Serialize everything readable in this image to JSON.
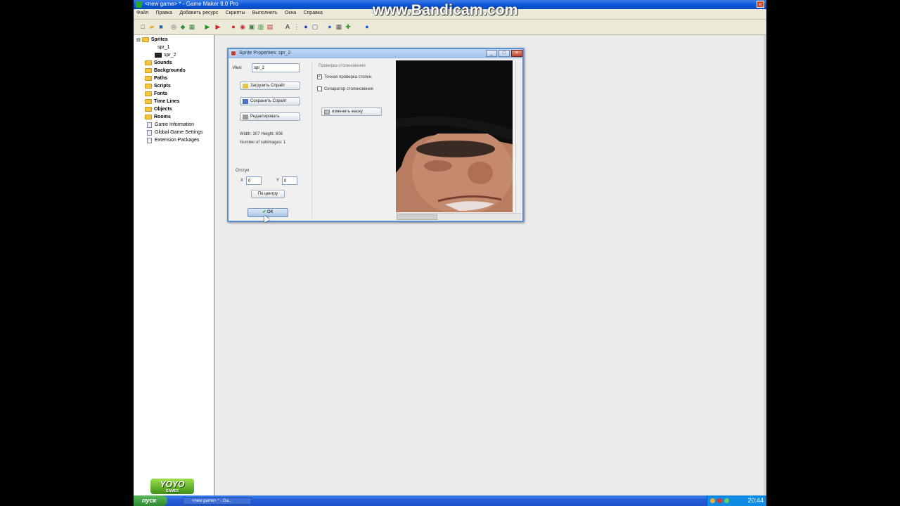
{
  "window": {
    "title": "<new game> * - Game Maker 8.0 Pro",
    "close_icon": "×"
  },
  "watermark": "www.Bandicam.com",
  "menu": [
    "Файл",
    "Правка",
    "Добавить ресурс",
    "Скрипты",
    "Выполнить",
    "Окна",
    "Справка"
  ],
  "toolbar_icons": [
    {
      "name": "new-icon",
      "glyph": "□",
      "color": "#555"
    },
    {
      "name": "open-icon",
      "glyph": "▰",
      "color": "#e0b02a"
    },
    {
      "name": "save-icon",
      "glyph": "■",
      "color": "#2a5fb0"
    },
    {
      "name": "find-icon",
      "glyph": "◎",
      "color": "#555"
    },
    {
      "name": "publish-icon",
      "glyph": "◆",
      "color": "#3a8a3a"
    },
    {
      "name": "export-icon",
      "glyph": "▦",
      "color": "#3a8a3a"
    },
    {
      "name": "run-icon",
      "glyph": "▶",
      "color": "#1a9a1a"
    },
    {
      "name": "debug-icon",
      "glyph": "▶",
      "color": "#d02020"
    },
    {
      "name": "sprite-icon",
      "glyph": "●",
      "color": "#d02020"
    },
    {
      "name": "sound-icon",
      "glyph": "◉",
      "color": "#c03030"
    },
    {
      "name": "background-icon",
      "glyph": "▣",
      "color": "#3a7a3a"
    },
    {
      "name": "path-icon",
      "glyph": "▥",
      "color": "#2a8a2a"
    },
    {
      "name": "script-icon",
      "glyph": "▤",
      "color": "#c03030"
    },
    {
      "name": "font-icon",
      "glyph": "A",
      "color": "#222"
    },
    {
      "name": "timeline-icon",
      "glyph": "⋮",
      "color": "#2a5fb0"
    },
    {
      "name": "object-icon",
      "glyph": "●",
      "color": "#1a44c8"
    },
    {
      "name": "room-icon",
      "glyph": "▢",
      "color": "#2a5fb0"
    },
    {
      "name": "game-info-icon",
      "glyph": "●",
      "color": "#2a6ad0"
    },
    {
      "name": "settings-icon",
      "glyph": "▦",
      "color": "#555"
    },
    {
      "name": "extension-icon",
      "glyph": "✚",
      "color": "#2a9a2a"
    },
    {
      "name": "help-icon",
      "glyph": "●",
      "color": "#1a5fd0"
    }
  ],
  "tree": {
    "sprites": "Sprites",
    "spr_1": "spr_1",
    "spr_2": "spr_2",
    "sounds": "Sounds",
    "backgrounds": "Backgrounds",
    "paths": "Paths",
    "scripts": "Scripts",
    "fonts": "Fonts",
    "time_lines": "Time Lines",
    "objects": "Objects",
    "rooms": "Rooms",
    "game_information": "Game Information",
    "global_game_settings": "Global Game Settings",
    "extension_packages": "Extension Packages"
  },
  "logo": {
    "text": "YOYO",
    "sub": "GAMES"
  },
  "dialog": {
    "title": "Sprite Properties: spr_2",
    "name_label": "Имя:",
    "name_value": "spr_2",
    "load_button": "Загрузить Спрайт",
    "save_button": "Сохранить Спрайт",
    "edit_button": "Редактировать",
    "width_height": "Width: 307    Height: 606",
    "subimages": "Number of subimages: 1",
    "origin_label": "Отступ",
    "x_label": "X",
    "x_value": "0",
    "y_label": "Y",
    "y_value": "0",
    "center_button": "По центру",
    "collision_title": "Проверка столкновения",
    "precise_collision": "Точная проверка столкн.",
    "precise_checked": "✓",
    "separate_masks": "Сепаратор столкновения",
    "mask_button": "изменить маску",
    "ok_button": "OK",
    "min_icon": "_",
    "max_icon": "□",
    "close_icon": "×"
  },
  "taskbar": {
    "start": "пуск",
    "task": "<new game> * - Ga...",
    "clock": "20:44"
  }
}
